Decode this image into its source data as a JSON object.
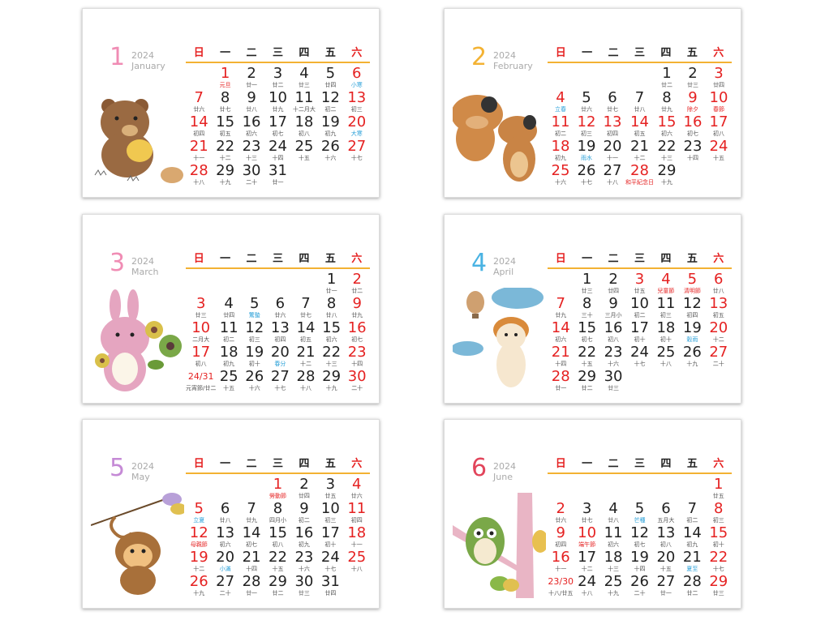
{
  "weekdays": [
    "日",
    "一",
    "二",
    "三",
    "四",
    "五",
    "六"
  ],
  "months": [
    {
      "num": "1",
      "year": "2024",
      "name": "January",
      "color": "#f08cb4",
      "art": "bear",
      "cells": [
        null,
        {
          "d": "1",
          "l": "元旦",
          "red": true,
          "lc": "red"
        },
        {
          "d": "2",
          "l": "廿一"
        },
        {
          "d": "3",
          "l": "廿二"
        },
        {
          "d": "4",
          "l": "廿三"
        },
        {
          "d": "5",
          "l": "廿四"
        },
        {
          "d": "6",
          "l": "小寒",
          "red": true,
          "lc": "blue"
        },
        {
          "d": "7",
          "l": "廿六",
          "red": true
        },
        {
          "d": "8",
          "l": "廿七"
        },
        {
          "d": "9",
          "l": "廿八"
        },
        {
          "d": "10",
          "l": "廿九"
        },
        {
          "d": "11",
          "l": "十二月大"
        },
        {
          "d": "12",
          "l": "初二"
        },
        {
          "d": "13",
          "l": "初三",
          "red": true
        },
        {
          "d": "14",
          "l": "初四",
          "red": true
        },
        {
          "d": "15",
          "l": "初五"
        },
        {
          "d": "16",
          "l": "初六"
        },
        {
          "d": "17",
          "l": "初七"
        },
        {
          "d": "18",
          "l": "初八"
        },
        {
          "d": "19",
          "l": "初九"
        },
        {
          "d": "20",
          "l": "大寒",
          "red": true,
          "lc": "blue"
        },
        {
          "d": "21",
          "l": "十一",
          "red": true
        },
        {
          "d": "22",
          "l": "十二"
        },
        {
          "d": "23",
          "l": "十三"
        },
        {
          "d": "24",
          "l": "十四"
        },
        {
          "d": "25",
          "l": "十五"
        },
        {
          "d": "26",
          "l": "十六"
        },
        {
          "d": "27",
          "l": "十七",
          "red": true
        },
        {
          "d": "28",
          "l": "十八",
          "red": true
        },
        {
          "d": "29",
          "l": "十九"
        },
        {
          "d": "30",
          "l": "二十"
        },
        {
          "d": "31",
          "l": "廿一"
        }
      ]
    },
    {
      "num": "2",
      "year": "2024",
      "name": "February",
      "color": "#f3b233",
      "art": "dogs",
      "cells": [
        null,
        null,
        null,
        null,
        {
          "d": "1",
          "l": "廿二"
        },
        {
          "d": "2",
          "l": "廿三"
        },
        {
          "d": "3",
          "l": "廿四",
          "red": true
        },
        {
          "d": "4",
          "l": "立春",
          "red": true,
          "lc": "blue"
        },
        {
          "d": "5",
          "l": "廿六"
        },
        {
          "d": "6",
          "l": "廿七"
        },
        {
          "d": "7",
          "l": "廿八"
        },
        {
          "d": "8",
          "l": "廿九"
        },
        {
          "d": "9",
          "l": "除夕",
          "red": true,
          "lc": "red"
        },
        {
          "d": "10",
          "l": "春節",
          "red": true,
          "lc": "red"
        },
        {
          "d": "11",
          "l": "初二",
          "red": true
        },
        {
          "d": "12",
          "l": "初三",
          "red": true
        },
        {
          "d": "13",
          "l": "初四",
          "red": true
        },
        {
          "d": "14",
          "l": "初五",
          "red": true
        },
        {
          "d": "15",
          "l": "初六",
          "red": true
        },
        {
          "d": "16",
          "l": "初七",
          "red": true
        },
        {
          "d": "17",
          "l": "初八",
          "red": true
        },
        {
          "d": "18",
          "l": "初九",
          "red": true
        },
        {
          "d": "19",
          "l": "雨水",
          "lc": "blue"
        },
        {
          "d": "20",
          "l": "十一"
        },
        {
          "d": "21",
          "l": "十二"
        },
        {
          "d": "22",
          "l": "十三"
        },
        {
          "d": "23",
          "l": "十四"
        },
        {
          "d": "24",
          "l": "十五",
          "red": true
        },
        {
          "d": "25",
          "l": "十六",
          "red": true
        },
        {
          "d": "26",
          "l": "十七"
        },
        {
          "d": "27",
          "l": "十八"
        },
        {
          "d": "28",
          "l": "和平紀念日",
          "red": true,
          "lc": "red"
        },
        {
          "d": "29",
          "l": "十九"
        }
      ]
    },
    {
      "num": "3",
      "year": "2024",
      "name": "March",
      "color": "#f08cb4",
      "art": "rabbit",
      "cells": [
        null,
        null,
        null,
        null,
        null,
        {
          "d": "1",
          "l": "廿一"
        },
        {
          "d": "2",
          "l": "廿二",
          "red": true
        },
        {
          "d": "3",
          "l": "廿三",
          "red": true
        },
        {
          "d": "4",
          "l": "廿四"
        },
        {
          "d": "5",
          "l": "驚蟄",
          "lc": "blue"
        },
        {
          "d": "6",
          "l": "廿六"
        },
        {
          "d": "7",
          "l": "廿七"
        },
        {
          "d": "8",
          "l": "廿八"
        },
        {
          "d": "9",
          "l": "廿九",
          "red": true
        },
        {
          "d": "10",
          "l": "二月大",
          "red": true
        },
        {
          "d": "11",
          "l": "初二"
        },
        {
          "d": "12",
          "l": "初三"
        },
        {
          "d": "13",
          "l": "初四"
        },
        {
          "d": "14",
          "l": "初五"
        },
        {
          "d": "15",
          "l": "初六"
        },
        {
          "d": "16",
          "l": "初七",
          "red": true
        },
        {
          "d": "17",
          "l": "初八",
          "red": true
        },
        {
          "d": "18",
          "l": "初九"
        },
        {
          "d": "19",
          "l": "初十"
        },
        {
          "d": "20",
          "l": "春分",
          "lc": "blue"
        },
        {
          "d": "21",
          "l": "十二"
        },
        {
          "d": "22",
          "l": "十三"
        },
        {
          "d": "23",
          "l": "十四",
          "red": true
        },
        {
          "d": "24/31",
          "l": "元宵節/廿二",
          "red": true,
          "split": true
        },
        {
          "d": "25",
          "l": "十五"
        },
        {
          "d": "26",
          "l": "十六"
        },
        {
          "d": "27",
          "l": "十七"
        },
        {
          "d": "28",
          "l": "十八"
        },
        {
          "d": "29",
          "l": "十九"
        },
        {
          "d": "30",
          "l": "二十",
          "red": true
        }
      ]
    },
    {
      "num": "4",
      "year": "2024",
      "name": "April",
      "color": "#4ab3e3",
      "art": "dog",
      "cells": [
        null,
        {
          "d": "1",
          "l": "廿三"
        },
        {
          "d": "2",
          "l": "廿四"
        },
        {
          "d": "3",
          "l": "廿五",
          "red": true
        },
        {
          "d": "4",
          "l": "兒童節",
          "red": true,
          "lc": "red"
        },
        {
          "d": "5",
          "l": "清明節",
          "red": true,
          "lc": "red"
        },
        {
          "d": "6",
          "l": "廿八",
          "red": true
        },
        {
          "d": "7",
          "l": "廿九",
          "red": true
        },
        {
          "d": "8",
          "l": "三十"
        },
        {
          "d": "9",
          "l": "三月小"
        },
        {
          "d": "10",
          "l": "初二"
        },
        {
          "d": "11",
          "l": "初三"
        },
        {
          "d": "12",
          "l": "初四"
        },
        {
          "d": "13",
          "l": "初五",
          "red": true
        },
        {
          "d": "14",
          "l": "初六",
          "red": true
        },
        {
          "d": "15",
          "l": "初七"
        },
        {
          "d": "16",
          "l": "初八"
        },
        {
          "d": "17",
          "l": "初十"
        },
        {
          "d": "18",
          "l": "初十"
        },
        {
          "d": "19",
          "l": "穀雨",
          "lc": "blue"
        },
        {
          "d": "20",
          "l": "十二",
          "red": true
        },
        {
          "d": "21",
          "l": "十四",
          "red": true
        },
        {
          "d": "22",
          "l": "十五"
        },
        {
          "d": "23",
          "l": "十六"
        },
        {
          "d": "24",
          "l": "十七"
        },
        {
          "d": "25",
          "l": "十八"
        },
        {
          "d": "26",
          "l": "十九"
        },
        {
          "d": "27",
          "l": "二十",
          "red": true
        },
        {
          "d": "28",
          "l": "廿一",
          "red": true
        },
        {
          "d": "29",
          "l": "廿二"
        },
        {
          "d": "30",
          "l": "廿三"
        }
      ]
    },
    {
      "num": "5",
      "year": "2024",
      "name": "May",
      "color": "#c58ad6",
      "art": "monkey",
      "cells": [
        null,
        null,
        null,
        {
          "d": "1",
          "l": "勞動節",
          "red": true,
          "lc": "red"
        },
        {
          "d": "2",
          "l": "廿四"
        },
        {
          "d": "3",
          "l": "廿五"
        },
        {
          "d": "4",
          "l": "廿六",
          "red": true
        },
        {
          "d": "5",
          "l": "立夏",
          "red": true,
          "lc": "blue"
        },
        {
          "d": "6",
          "l": "廿八"
        },
        {
          "d": "7",
          "l": "廿九"
        },
        {
          "d": "8",
          "l": "四月小"
        },
        {
          "d": "9",
          "l": "初二"
        },
        {
          "d": "10",
          "l": "初三"
        },
        {
          "d": "11",
          "l": "初四",
          "red": true
        },
        {
          "d": "12",
          "l": "母親節",
          "red": true,
          "lc": "red"
        },
        {
          "d": "13",
          "l": "初六"
        },
        {
          "d": "14",
          "l": "初七"
        },
        {
          "d": "15",
          "l": "初八"
        },
        {
          "d": "16",
          "l": "初九"
        },
        {
          "d": "17",
          "l": "初十"
        },
        {
          "d": "18",
          "l": "十一",
          "red": true
        },
        {
          "d": "19",
          "l": "十二",
          "red": true
        },
        {
          "d": "20",
          "l": "小滿",
          "lc": "blue"
        },
        {
          "d": "21",
          "l": "十四"
        },
        {
          "d": "22",
          "l": "十五"
        },
        {
          "d": "23",
          "l": "十六"
        },
        {
          "d": "24",
          "l": "十七"
        },
        {
          "d": "25",
          "l": "十八",
          "red": true
        },
        {
          "d": "26",
          "l": "十九",
          "red": true
        },
        {
          "d": "27",
          "l": "二十"
        },
        {
          "d": "28",
          "l": "廿一"
        },
        {
          "d": "29",
          "l": "廿二"
        },
        {
          "d": "30",
          "l": "廿三"
        },
        {
          "d": "31",
          "l": "廿四"
        }
      ]
    },
    {
      "num": "6",
      "year": "2024",
      "name": "June",
      "color": "#e2455b",
      "art": "owl",
      "cells": [
        null,
        null,
        null,
        null,
        null,
        null,
        {
          "d": "1",
          "l": "廿五",
          "red": true
        },
        {
          "d": "2",
          "l": "廿六",
          "red": true
        },
        {
          "d": "3",
          "l": "廿七"
        },
        {
          "d": "4",
          "l": "廿八"
        },
        {
          "d": "5",
          "l": "芒種",
          "lc": "blue"
        },
        {
          "d": "6",
          "l": "五月大"
        },
        {
          "d": "7",
          "l": "初二"
        },
        {
          "d": "8",
          "l": "初三",
          "red": true
        },
        {
          "d": "9",
          "l": "初四",
          "red": true
        },
        {
          "d": "10",
          "l": "端午節",
          "red": true,
          "lc": "red"
        },
        {
          "d": "11",
          "l": "初六"
        },
        {
          "d": "12",
          "l": "初七"
        },
        {
          "d": "13",
          "l": "初八"
        },
        {
          "d": "14",
          "l": "初九"
        },
        {
          "d": "15",
          "l": "初十",
          "red": true
        },
        {
          "d": "16",
          "l": "十一",
          "red": true
        },
        {
          "d": "17",
          "l": "十二"
        },
        {
          "d": "18",
          "l": "十三"
        },
        {
          "d": "19",
          "l": "十四"
        },
        {
          "d": "20",
          "l": "十五"
        },
        {
          "d": "21",
          "l": "夏至",
          "lc": "blue"
        },
        {
          "d": "22",
          "l": "十七",
          "red": true
        },
        {
          "d": "23/30",
          "l": "十八/廿五",
          "red": true,
          "split": true
        },
        {
          "d": "24",
          "l": "十八"
        },
        {
          "d": "25",
          "l": "十九"
        },
        {
          "d": "26",
          "l": "二十"
        },
        {
          "d": "27",
          "l": "廿一"
        },
        {
          "d": "28",
          "l": "廿二"
        },
        {
          "d": "29",
          "l": "廿三",
          "red": true
        }
      ]
    }
  ]
}
